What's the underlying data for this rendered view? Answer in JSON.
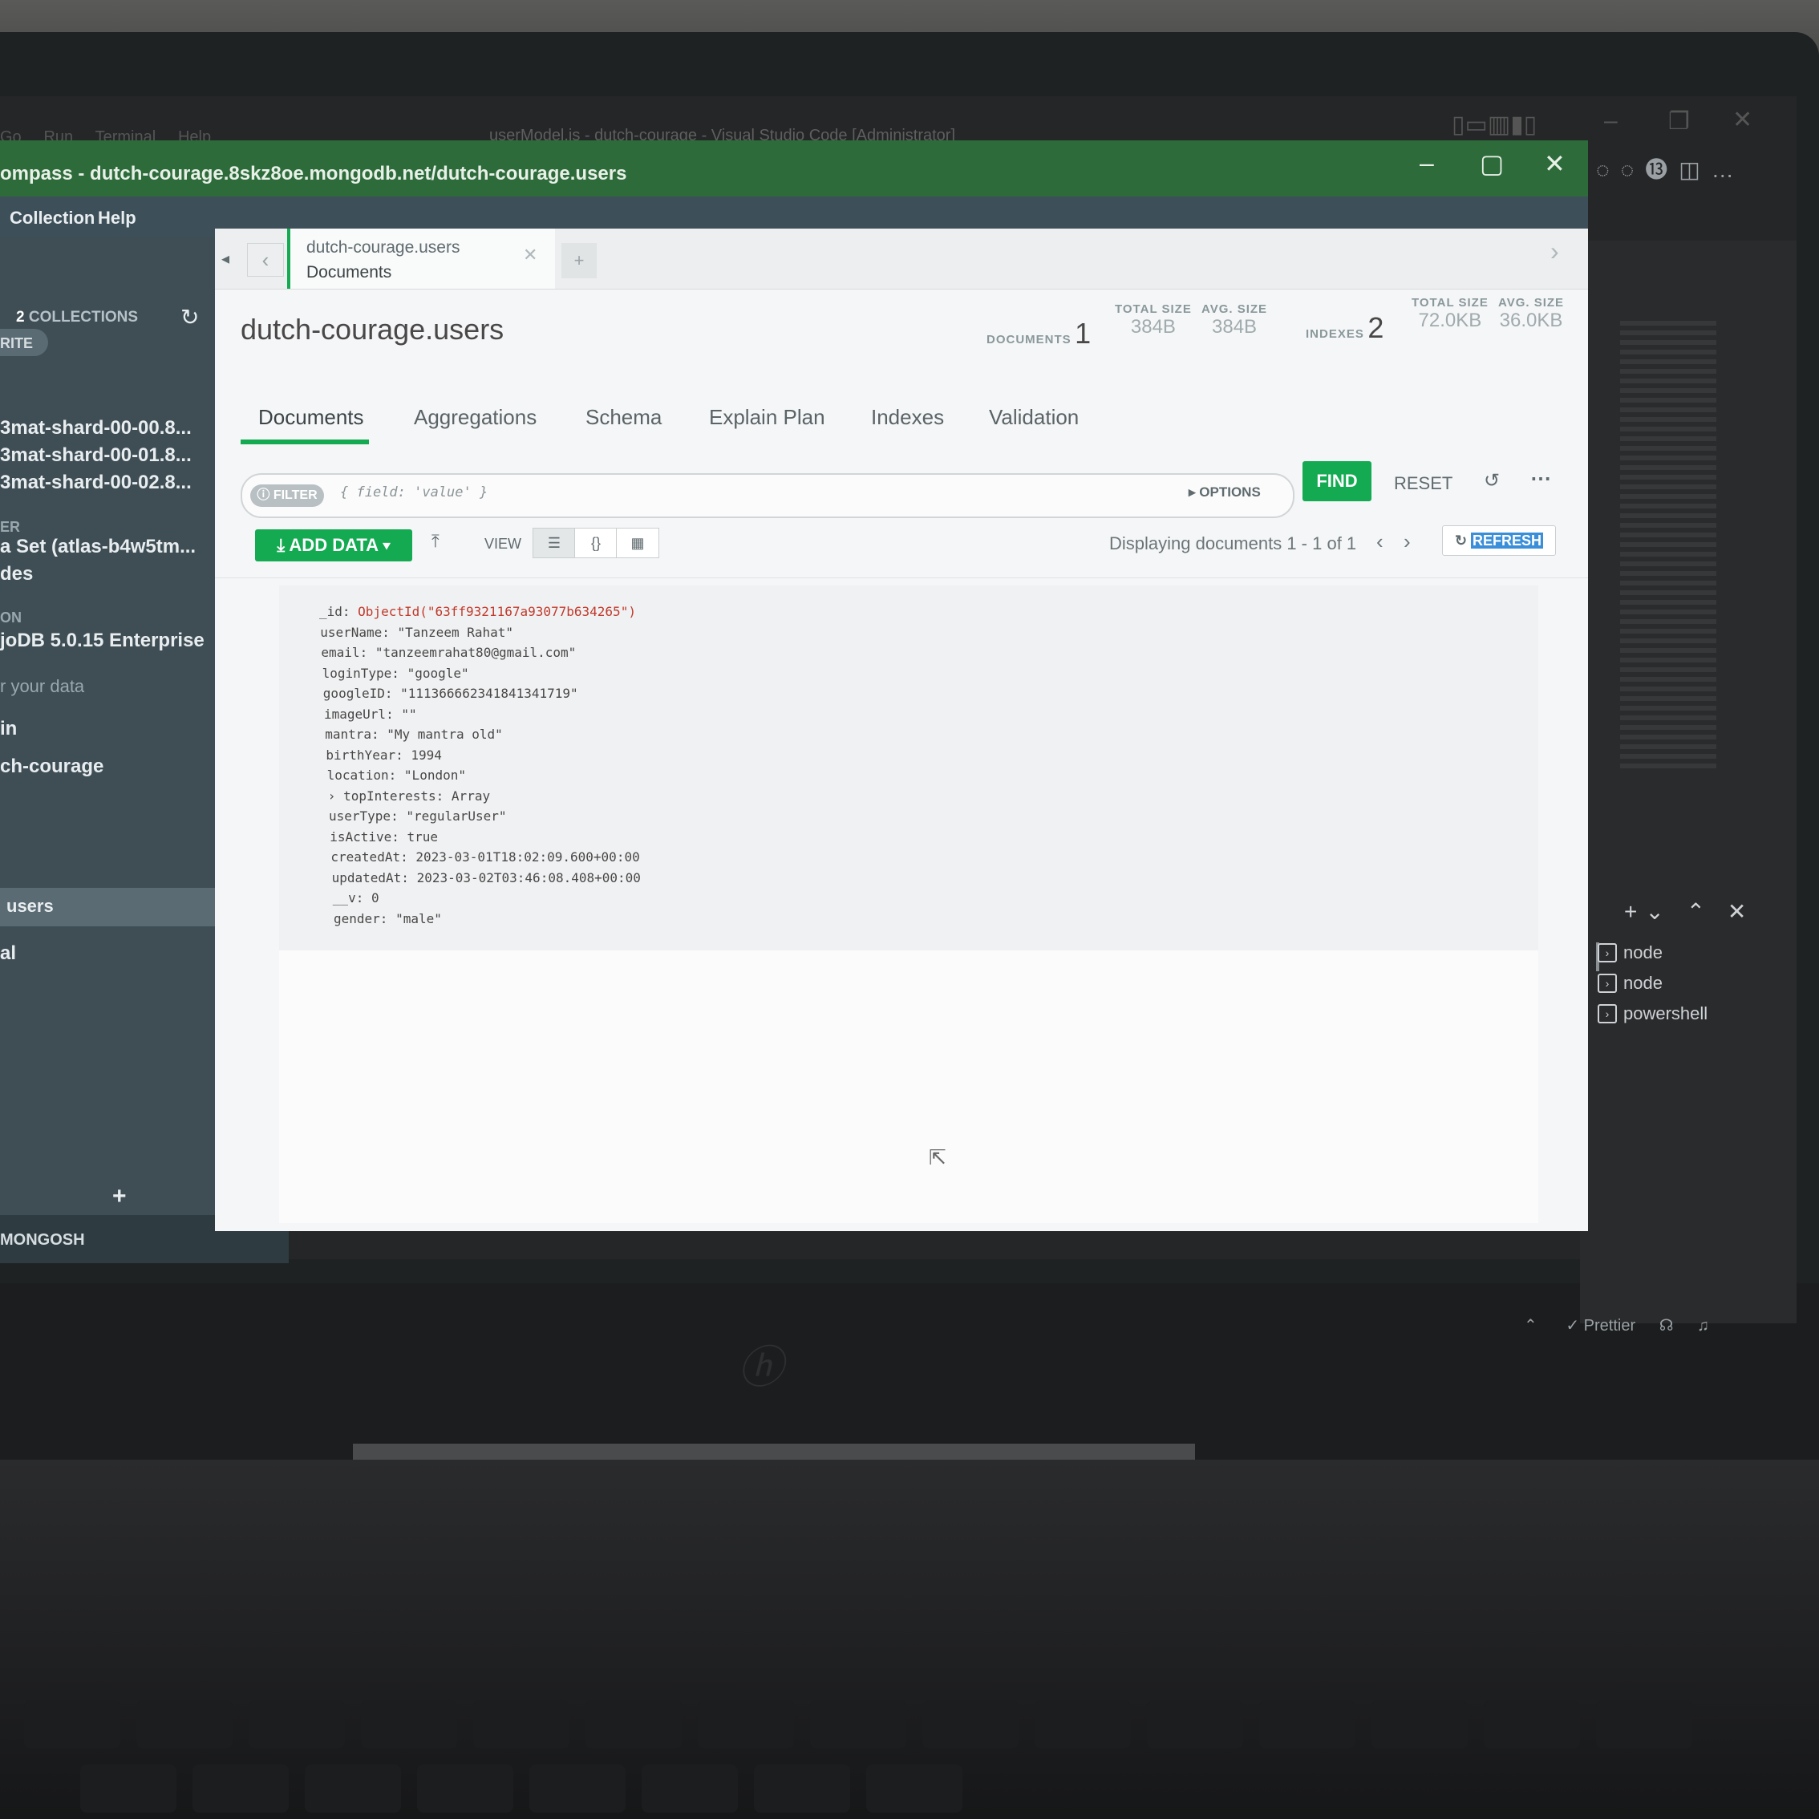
{
  "vscode": {
    "menu": [
      "Go",
      "Run",
      "Terminal",
      "Help"
    ],
    "title": "userModel.js - dutch-courage - Visual Studio Code [Administrator]",
    "terminals": [
      "node",
      "node",
      "powershell"
    ],
    "status": {
      "prettier": "Prettier"
    }
  },
  "compass": {
    "title": "ompass - dutch-courage.8skz8oe.mongodb.net/dutch-courage.users",
    "menu": {
      "collection": "Collection",
      "help": "Help"
    }
  },
  "sidebar": {
    "collections_count": "2",
    "collections_label": "COLLECTIONS",
    "section_write": "RITE",
    "hosts": [
      "3mat-shard-00-00.8...",
      "3mat-shard-00-01.8...",
      "3mat-shard-00-02.8..."
    ],
    "section_cluster": "ER",
    "replica_set": "a Set (atlas-b4w5tm...",
    "nodes": "des",
    "section_version": "ON",
    "version": "joDB 5.0.15 Enterprise",
    "filter_placeholder": "r your data",
    "db_admin": "in",
    "db_main": "ch-courage",
    "collection_users": "users",
    "db_local": "al",
    "mongosh": "MONGOSH"
  },
  "tab": {
    "namespace": "dutch-courage.users",
    "subtitle": "Documents"
  },
  "header": {
    "namespace": "dutch-courage.users",
    "documents_label": "DOCUMENTS",
    "documents_count": "1",
    "doc_total_size_label": "TOTAL SIZE",
    "doc_total_size": "384B",
    "doc_avg_size_label": "AVG. SIZE",
    "doc_avg_size": "384B",
    "indexes_label": "INDEXES",
    "indexes_count": "2",
    "idx_total_size_label": "TOTAL SIZE",
    "idx_total_size": "72.0KB",
    "idx_avg_size_label": "AVG. SIZE",
    "idx_avg_size": "36.0KB"
  },
  "subtabs": [
    "Documents",
    "Aggregations",
    "Schema",
    "Explain Plan",
    "Indexes",
    "Validation"
  ],
  "query": {
    "filter_label": "FILTER",
    "filter_placeholder": "{ field: 'value' }",
    "options_label": "OPTIONS",
    "find_label": "FIND",
    "reset_label": "RESET"
  },
  "toolbar": {
    "add_data_label": "ADD DATA",
    "view_label": "VIEW",
    "display_text": "Displaying documents 1 - 1 of 1",
    "refresh_label": "REFRESH"
  },
  "document": [
    {
      "key": "_id",
      "value": "ObjectId(\"63ff9321167a93077b634265\")",
      "kind": "oid"
    },
    {
      "key": "userName",
      "value": "\"Tanzeem Rahat\"",
      "kind": "str"
    },
    {
      "key": "email",
      "value": "\"tanzeemrahat80@gmail.com\"",
      "kind": "str"
    },
    {
      "key": "loginType",
      "value": "\"google\"",
      "kind": "str"
    },
    {
      "key": "googleID",
      "value": "\"111366662341841341719\"",
      "kind": "str"
    },
    {
      "key": "imageUrl",
      "value": "\"\"",
      "kind": "str"
    },
    {
      "key": "mantra",
      "value": "\"My mantra old\"",
      "kind": "str"
    },
    {
      "key": "birthYear",
      "value": "1994",
      "kind": "num"
    },
    {
      "key": "location",
      "value": "\"London\"",
      "kind": "str"
    },
    {
      "key": "topInterests",
      "value": "Array",
      "kind": "arr"
    },
    {
      "key": "userType",
      "value": "\"regularUser\"",
      "kind": "str"
    },
    {
      "key": "isActive",
      "value": "true",
      "kind": "bool"
    },
    {
      "key": "createdAt",
      "value": "2023-03-01T18:02:09.600+00:00",
      "kind": "date"
    },
    {
      "key": "updatedAt",
      "value": "2023-03-02T03:46:08.408+00:00",
      "kind": "date"
    },
    {
      "key": "__v",
      "value": "0",
      "kind": "num"
    },
    {
      "key": "gender",
      "value": "\"male\"",
      "kind": "str"
    }
  ]
}
